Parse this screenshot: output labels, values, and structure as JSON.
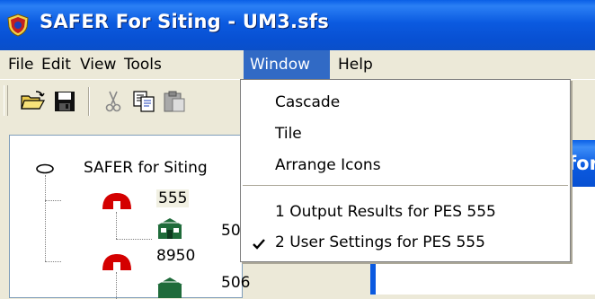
{
  "window": {
    "title": "SAFER For Siting - UM3.sfs"
  },
  "menubar": {
    "items": [
      {
        "label": "File"
      },
      {
        "label": "Edit"
      },
      {
        "label": "View"
      },
      {
        "label": "Tools"
      },
      {
        "label": "Window",
        "active": true
      },
      {
        "label": "Help"
      }
    ]
  },
  "toolbar": {
    "buttons": [
      "open-folder-icon",
      "save-icon",
      "cut-icon",
      "copy-icon",
      "paste-icon"
    ]
  },
  "tree": {
    "root_label": "SAFER for Siting",
    "nodes": [
      {
        "label": "555",
        "icon": "pes-dome-icon",
        "selected": true
      },
      {
        "label": "50",
        "icon": "building-icon"
      },
      {
        "label": "8950",
        "icon": "pes-dome-icon"
      },
      {
        "label": "506",
        "icon": "building-icon"
      }
    ]
  },
  "child_window": {
    "title_fragment": "for"
  },
  "window_menu": {
    "items": [
      {
        "label": "Cascade"
      },
      {
        "label": "Tile"
      },
      {
        "label": "Arrange Icons"
      },
      {
        "label": "1 Output Results for PES 555"
      },
      {
        "label": "2 User Settings for PES 555",
        "checked": true
      }
    ]
  },
  "colors": {
    "title_blue": "#0b5ae0",
    "menu_highlight": "#316ac5",
    "face": "#ece9d8",
    "pes_red": "#d40000",
    "building_green": "#1f6b3a"
  }
}
